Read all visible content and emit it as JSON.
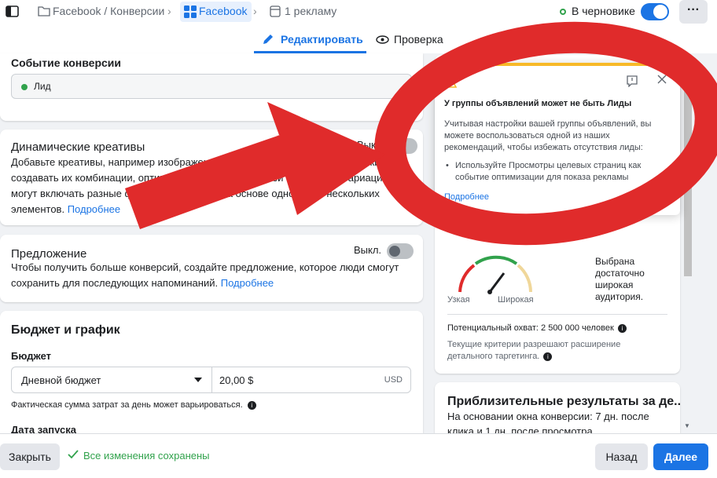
{
  "topbar": {
    "breadcrumb_campaign": "Facebook / Конверсии",
    "breadcrumb_adset": "Facebook",
    "breadcrumb_ads": "1 рекламу",
    "draft_status": "В черновике",
    "more_label": "···"
  },
  "tabs": {
    "edit": "Редактировать",
    "review": "Проверка"
  },
  "conversion": {
    "title": "Событие конверсии",
    "value": "Лид",
    "status_color": "#31a24c"
  },
  "dynamic": {
    "title": "Динамические креативы",
    "toggle_label": "Выкл.",
    "description": "Добавьте креативы, например изображения и заголовки, и мы автоматически создавать их комбинации, оптимизированные для вашей аудитории. Вариации могут включать разные форматы, шаблоны на основе одного или нескольких элементов.",
    "link": "Подробнее"
  },
  "offer": {
    "title": "Предложение",
    "toggle_label": "Выкл.",
    "description": "Чтобы получить больше конверсий, создайте предложение, которое люди смогут сохранить для последующих напоминаний.",
    "link": "Подробнее"
  },
  "budget": {
    "title": "Бюджет и график",
    "label": "Бюджет",
    "type": "Дневной бюджет",
    "amount": "20,00 $",
    "currency": "USD",
    "note": "Фактическая сумма затрат за день может варьироваться.",
    "start_label": "Дата запуска"
  },
  "popover": {
    "title": "У группы объявлений может не быть Лиды",
    "body": "Учитывая настройки вашей группы объявлений, вы можете воспользоваться одной из наших рекомендаций, чтобы избежать отсутствия лиды:",
    "bullet": "Используйте Просмотры целевых страниц как событие оптимизации для показа рекламы",
    "link": "Подробнее"
  },
  "audience": {
    "summary": "Выбрана достаточно широкая аудитория.",
    "narrow": "Узкая",
    "wide": "Широкая",
    "reach": "Потенциальный охват: 2 500 000 человек",
    "expansion": "Текущие критерии разрешают расширение детального таргетинга.",
    "gauge_level": 0.72
  },
  "results": {
    "title": "Приблизительные результаты за де...",
    "body": "На основании окна конверсии: 7 дн. после клика и 1 дн. после просмотра"
  },
  "footer": {
    "close": "Закрыть",
    "saved": "Все изменения сохранены",
    "back": "Назад",
    "next": "Далее"
  },
  "colors": {
    "accent": "#1b74e4",
    "warning": "#f7b928",
    "annotation": "#e02b2b",
    "success": "#31a24c"
  }
}
